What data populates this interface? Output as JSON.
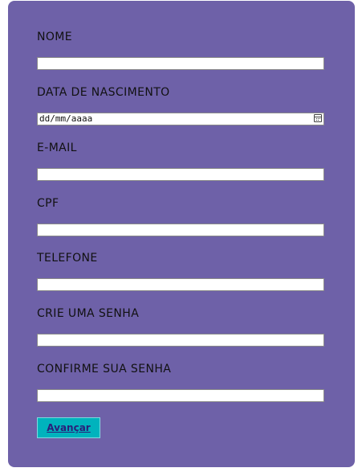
{
  "form": {
    "fields": [
      {
        "label": "NOME",
        "value": "",
        "type": "text"
      },
      {
        "label": "DATA DE NASCIMENTO",
        "value": "",
        "placeholder": "dd/mm/aaaa",
        "type": "date"
      },
      {
        "label": "E-MAIL",
        "value": "",
        "type": "email"
      },
      {
        "label": "CPF",
        "value": "",
        "type": "text"
      },
      {
        "label": "TELEFONE",
        "value": "",
        "type": "tel"
      },
      {
        "label": "CRIE UMA SENHA",
        "value": "",
        "type": "password"
      },
      {
        "label": "CONFIRME SUA SENHA",
        "value": "",
        "type": "password"
      }
    ],
    "submit_label": "Avançar"
  },
  "colors": {
    "card_background": "#6e61a8",
    "button_background": "#00b3bd",
    "button_text": "#2a1f7a"
  },
  "icons": {
    "date_picker": "calendar-icon"
  }
}
